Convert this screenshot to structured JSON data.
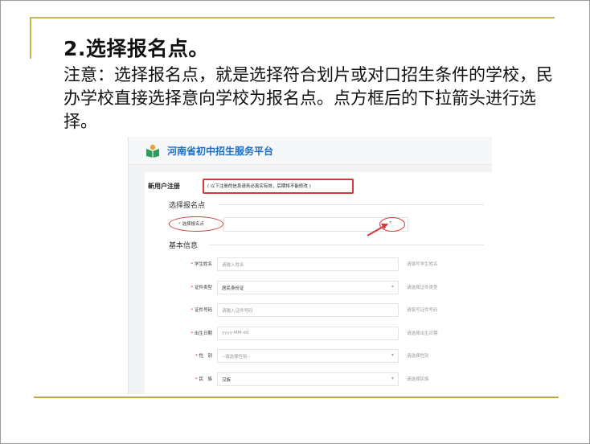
{
  "slide": {
    "title": "2.选择报名点。",
    "body": "注意：选择报名点，就是选择符合划片或对口招生条件的学校，民办学校直接选择意向学校为报名点。点方框后的下拉箭头进行选择。"
  },
  "platform": {
    "name": "河南省初中招生服务平台"
  },
  "registration": {
    "title": "新用户注册",
    "note": "( 以下注册的信息请务必真实有效，后期将不能修改 )"
  },
  "section_select": {
    "title": "选择报名点",
    "required_mark": "*",
    "label": "选择报名点"
  },
  "section_basic": {
    "title": "基本信息"
  },
  "fields": [
    {
      "label": "学生姓名",
      "placeholder": "请输入姓名",
      "value": "",
      "hint": "请填写学生姓名",
      "dropdown": false
    },
    {
      "label": "证件类型",
      "placeholder": "",
      "value": "居民身份证",
      "hint": "请选择证件类型",
      "dropdown": true
    },
    {
      "label": "证件号码",
      "placeholder": "请输入证件号码",
      "value": "",
      "hint": "请填写证件号码",
      "dropdown": false
    },
    {
      "label": "出生日期",
      "placeholder": "yyyy-MM-dd",
      "value": "",
      "hint": "请选择出生日期",
      "dropdown": false
    },
    {
      "label": "性　别",
      "placeholder": "--请选择性别--",
      "value": "",
      "hint": "请选择性别",
      "dropdown": true
    },
    {
      "label": "民　族",
      "placeholder": "",
      "value": "汉族",
      "hint": "请选择民族",
      "dropdown": true
    }
  ],
  "colors": {
    "accent": "#1d6fc4",
    "highlight": "#d23a3a",
    "rule": "#c8b45a"
  }
}
